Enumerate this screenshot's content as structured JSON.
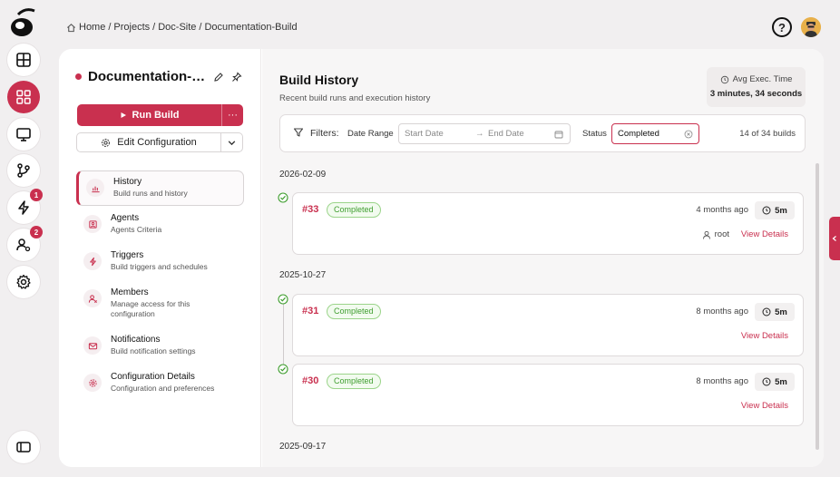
{
  "breadcrumb": {
    "items": [
      "Home",
      "Projects",
      "Doc-Site",
      "Documentation-Build"
    ],
    "separator": "/"
  },
  "header": {
    "help_icon": "question-circle-icon"
  },
  "rail": {
    "items": [
      {
        "name": "dashboard",
        "icon": "layout-icon"
      },
      {
        "name": "projects",
        "icon": "grid-icon",
        "active": true
      },
      {
        "name": "monitor",
        "icon": "monitor-icon"
      },
      {
        "name": "git",
        "icon": "git-branch-icon"
      },
      {
        "name": "alerts",
        "icon": "lightning-icon",
        "badge": "1"
      },
      {
        "name": "users",
        "icon": "user-settings-icon",
        "badge": "2"
      },
      {
        "name": "settings",
        "icon": "gear-icon"
      },
      {
        "name": "collapse",
        "icon": "sidebar-toggle-icon"
      }
    ]
  },
  "config": {
    "title": "Documentation-Build",
    "run_label": "Run Build",
    "more_label": "···",
    "edit_label": "Edit Configuration"
  },
  "nav": {
    "items": [
      {
        "label": "History",
        "desc": "Build runs and history"
      },
      {
        "label": "Agents",
        "desc": "Agents Criteria"
      },
      {
        "label": "Triggers",
        "desc": "Build triggers and schedules"
      },
      {
        "label": "Members",
        "desc": "Manage access for this configuration"
      },
      {
        "label": "Notifications",
        "desc": "Build notification settings"
      },
      {
        "label": "Configuration Details",
        "desc": "Configuration and preferences"
      }
    ]
  },
  "history": {
    "title": "Build History",
    "subtitle": "Recent build runs and execution history",
    "avg_label": "Avg Exec. Time",
    "avg_value": "3 minutes, 34 seconds"
  },
  "filters": {
    "label": "Filters:",
    "date_label": "Date Range",
    "start_placeholder": "Start Date",
    "arrow": "→",
    "end_placeholder": "End Date",
    "status_label": "Status",
    "status_value": "Completed",
    "count": "14 of 34 builds"
  },
  "groups": [
    {
      "date": "2026-02-09",
      "builds": [
        {
          "num": "#33",
          "status": "Completed",
          "ago": "4 months ago",
          "duration": "5m",
          "user": "root",
          "view": "View Details"
        }
      ]
    },
    {
      "date": "2025-10-27",
      "builds": [
        {
          "num": "#31",
          "status": "Completed",
          "ago": "8 months ago",
          "duration": "5m",
          "view": "View Details"
        },
        {
          "num": "#30",
          "status": "Completed",
          "ago": "8 months ago",
          "duration": "5m",
          "view": "View Details"
        }
      ]
    },
    {
      "date": "2025-09-17",
      "builds": []
    }
  ],
  "colors": {
    "accent": "#c9304f",
    "success": "#3f9e2f"
  }
}
